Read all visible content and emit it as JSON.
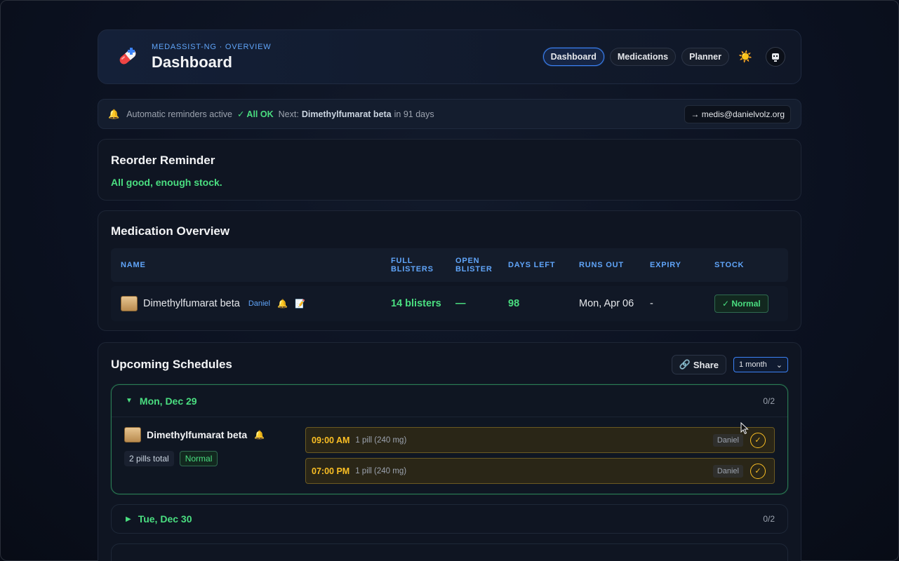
{
  "header": {
    "kicker": "MEDASSIST-NG · OVERVIEW",
    "title": "Dashboard",
    "nav": [
      "Dashboard",
      "Medications",
      "Planner"
    ],
    "active_nav": "Dashboard"
  },
  "reminder_bar": {
    "label": "Automatic reminders active",
    "status": "✓ All OK",
    "next_label": "Next:",
    "next_med": "Dimethylfumarat beta",
    "next_when": "in 91 days",
    "email": "→ medis@danielvolz.org"
  },
  "reorder": {
    "title": "Reorder Reminder",
    "message": "All good, enough stock."
  },
  "overview": {
    "title": "Medication Overview",
    "columns": [
      "NAME",
      "FULL BLISTERS",
      "OPEN BLISTER",
      "DAYS LEFT",
      "RUNS OUT",
      "EXPIRY",
      "STOCK"
    ],
    "rows": [
      {
        "name": "Dimethylfumarat beta",
        "owner": "Daniel",
        "full_blisters": "14 blisters",
        "open_blister": "—",
        "days_left": "98",
        "runs_out": "Mon, Apr 06",
        "expiry": "-",
        "stock": "✓ Normal"
      }
    ]
  },
  "schedules": {
    "title": "Upcoming Schedules",
    "share_label": "Share",
    "range": "1 month",
    "days": [
      {
        "label": "Mon, Dec 29",
        "count": "0/2",
        "med": {
          "name": "Dimethylfumarat beta",
          "total": "2 pills total",
          "status": "Normal"
        },
        "doses": [
          {
            "time": "09:00 AM",
            "detail": "1 pill (240 mg)",
            "person": "Daniel"
          },
          {
            "time": "07:00 PM",
            "detail": "1 pill (240 mg)",
            "person": "Daniel"
          }
        ]
      },
      {
        "label": "Tue, Dec 30",
        "count": "0/2"
      }
    ]
  },
  "colors": {
    "accent": "#3b82f6",
    "success": "#4ade80",
    "warning": "#fbbf24"
  },
  "icons": [
    "pill-icon",
    "sun-icon",
    "robot-avatar-icon",
    "bell-icon",
    "link-icon",
    "chevron-down-icon",
    "check-circle-icon",
    "edit-icon"
  ]
}
